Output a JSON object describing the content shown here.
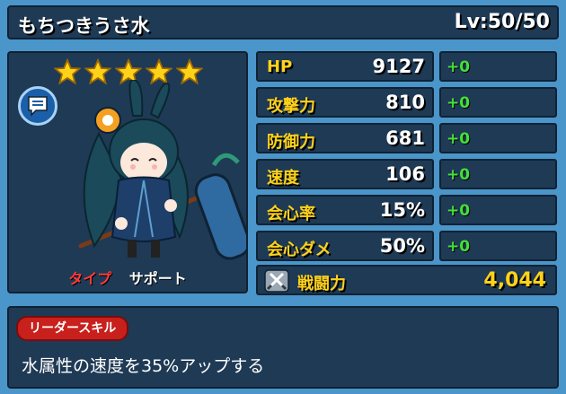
{
  "header": {
    "name": "もちつきうさ水",
    "level": "Lv:50/50"
  },
  "character": {
    "stars": 5,
    "type_label": "タイプ",
    "type_value": "サポート"
  },
  "stats": [
    {
      "name": "HP",
      "value": "9127",
      "bonus": "+0"
    },
    {
      "name": "攻撃力",
      "value": "810",
      "bonus": "+0"
    },
    {
      "name": "防御力",
      "value": "681",
      "bonus": "+0"
    },
    {
      "name": "速度",
      "value": "106",
      "bonus": "+0"
    },
    {
      "name": "会心率",
      "value": "15%",
      "bonus": "+0"
    },
    {
      "name": "会心ダメ",
      "value": "50%",
      "bonus": "+0"
    }
  ],
  "power": {
    "label": "戦闘力",
    "value": "4,044"
  },
  "leader_skill": {
    "badge": "リーダースキル",
    "text": "水属性の速度を35%アップする"
  },
  "colors": {
    "panel": "#1f3a55",
    "background": "#4a95c9",
    "stat_label": "#ffd21a",
    "bonus": "#45e03a",
    "badge": "#c8201c"
  }
}
